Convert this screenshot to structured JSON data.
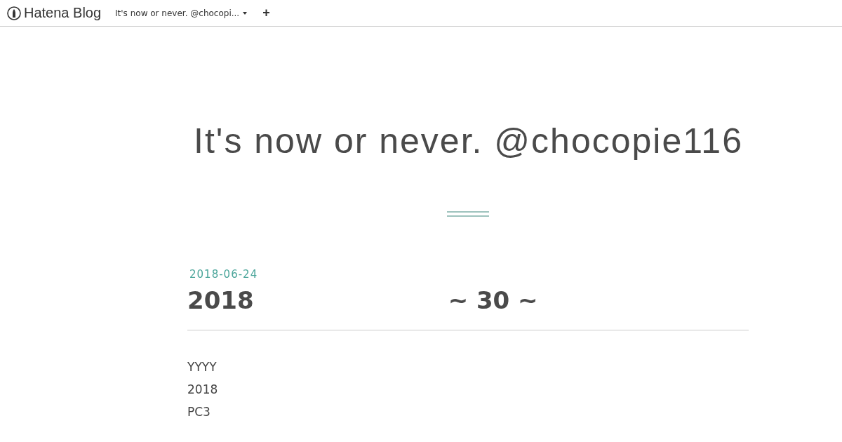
{
  "navbar": {
    "logo": "Hatena Blog",
    "blog_menu": "It's now or never. @chocopi...",
    "add_button": "+"
  },
  "blog_title": "It's now or never. @chocopie116",
  "entry": {
    "date": "2018-06-24",
    "title_parts": [
      "2018",
      "~ 30 ~"
    ],
    "body_lines": [
      "YYYY",
      "2018",
      "PC3"
    ]
  }
}
